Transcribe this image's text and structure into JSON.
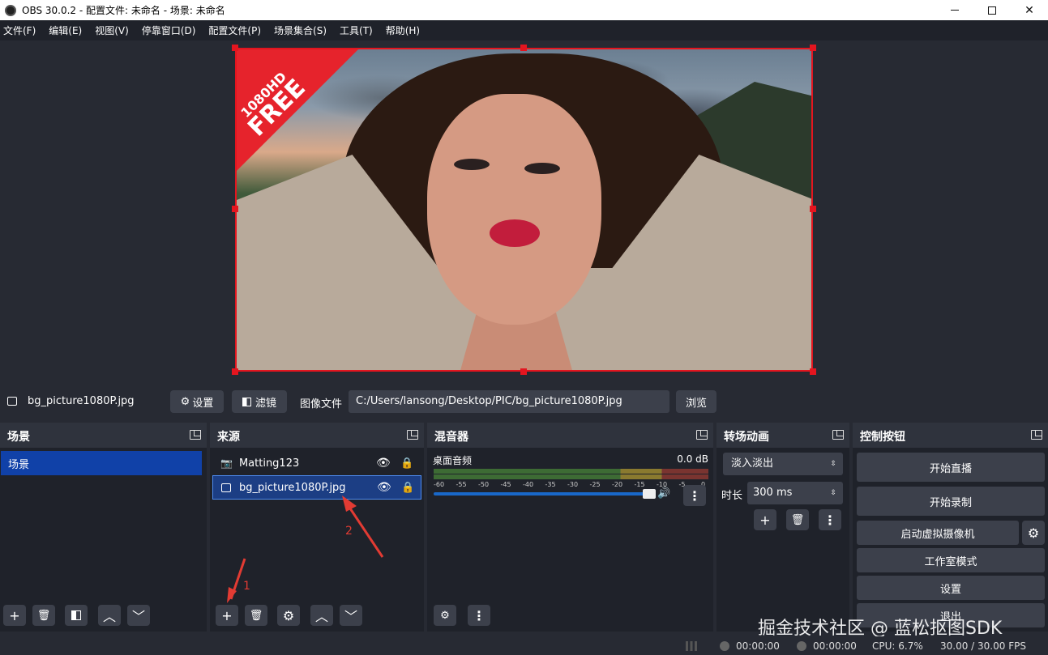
{
  "window": {
    "title": "OBS 30.0.2 - 配置文件: 未命名 - 场景: 未命名"
  },
  "menu": [
    "文件(F)",
    "编辑(E)",
    "视图(V)",
    "停靠窗口(D)",
    "配置文件(P)",
    "场景集合(S)",
    "工具(T)",
    "帮助(H)"
  ],
  "preview": {
    "badge_line1": "1080HD",
    "badge_line2": "FREE"
  },
  "context": {
    "source_name": "bg_picture1080P.jpg",
    "settings_label": "设置",
    "filters_label": "滤镜",
    "image_file_label": "图像文件",
    "path": "C:/Users/lansong/Desktop/PIC/bg_picture1080P.jpg",
    "browse_label": "浏览"
  },
  "scenes": {
    "title": "场景",
    "items": [
      "场景"
    ]
  },
  "sources": {
    "title": "来源",
    "items": [
      "Matting123",
      "bg_picture1080P.jpg"
    ]
  },
  "mixer": {
    "title": "混音器",
    "channel": "桌面音频",
    "db": "0.0 dB",
    "ticks": [
      "-60",
      "-55",
      "-50",
      "-45",
      "-40",
      "-35",
      "-30",
      "-25",
      "-20",
      "-15",
      "-10",
      "-5",
      "0"
    ],
    "volume": 1.0
  },
  "transitions": {
    "title": "转场动画",
    "selected": "淡入淡出",
    "duration_label": "时长",
    "duration": "300 ms"
  },
  "controls": {
    "title": "控制按钮",
    "start_stream": "开始直播",
    "start_record": "开始录制",
    "virtual_cam": "启动虚拟摄像机",
    "studio_mode": "工作室模式",
    "settings": "设置",
    "exit": "退出"
  },
  "status": {
    "stream_time": "00:00:00",
    "record_time": "00:00:00",
    "cpu": "CPU: 6.7%",
    "fps": "30.00 / 30.00 FPS"
  },
  "annotations": {
    "one": "1",
    "two": "2"
  },
  "watermark": "掘金技术社区 @ 蓝松抠图SDK",
  "colors": {
    "accent": "#1041a8",
    "selection_border": "#e4151f",
    "annotation": "#e23b33"
  }
}
